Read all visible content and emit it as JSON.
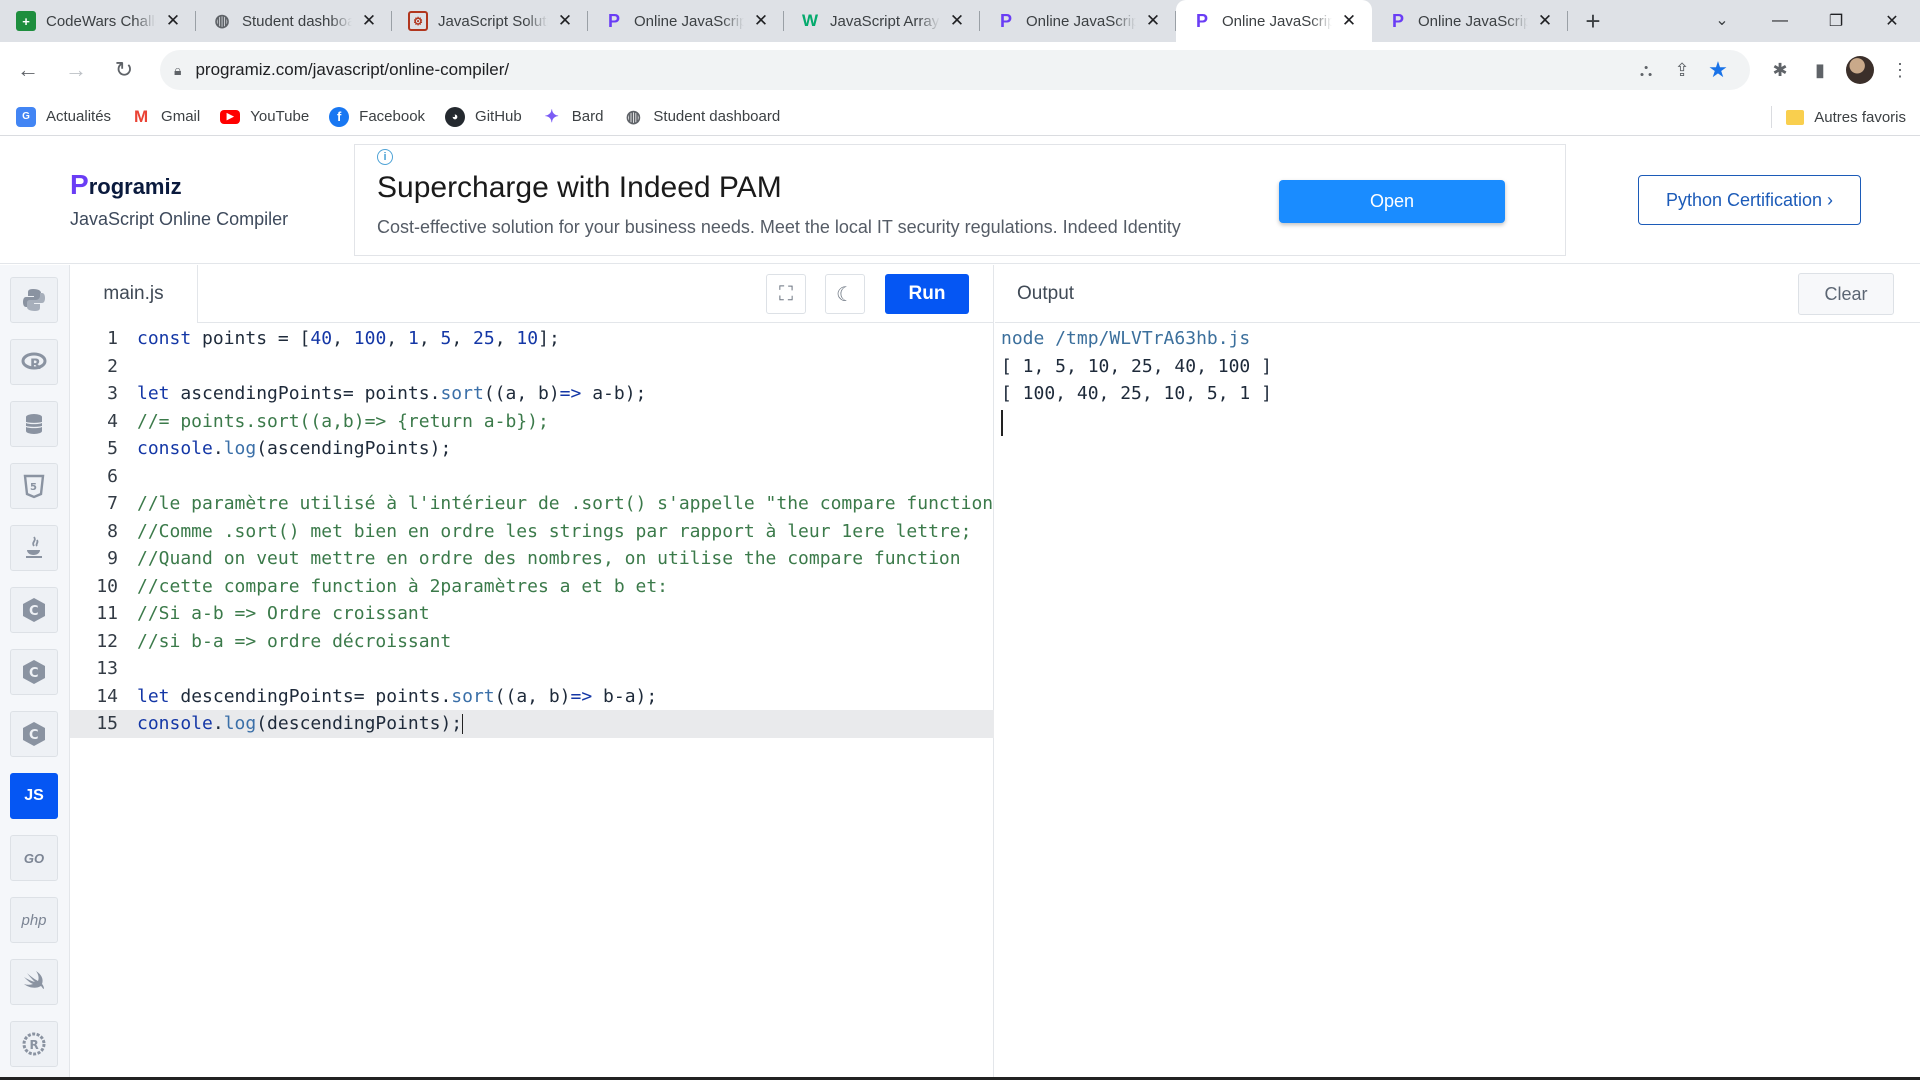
{
  "browser": {
    "tabs": [
      {
        "title": "CodeWars Challenges",
        "favicon": "green-plus-icon"
      },
      {
        "title": "Student dashboard",
        "favicon": "globe-icon"
      },
      {
        "title": "JavaScript Solutions",
        "favicon": "codewars-icon"
      },
      {
        "title": "Online JavaScript Compiler",
        "favicon": "programiz-icon"
      },
      {
        "title": "JavaScript Array Sort",
        "favicon": "w3schools-icon"
      },
      {
        "title": "Online JavaScript Compiler",
        "favicon": "programiz-icon"
      },
      {
        "title": "Online JavaScript Compiler",
        "favicon": "programiz-icon",
        "active": true
      },
      {
        "title": "Online JavaScript Compiler",
        "favicon": "programiz-icon"
      }
    ],
    "url": "programiz.com/javascript/online-compiler/",
    "bookmarks": [
      {
        "label": "Actualités",
        "icon": "news-icon"
      },
      {
        "label": "Gmail",
        "icon": "gmail-icon"
      },
      {
        "label": "YouTube",
        "icon": "youtube-icon"
      },
      {
        "label": "Facebook",
        "icon": "facebook-icon"
      },
      {
        "label": "GitHub",
        "icon": "github-icon"
      },
      {
        "label": "Bard",
        "icon": "bard-icon"
      },
      {
        "label": "Student dashboard",
        "icon": "globe-icon"
      }
    ],
    "other_bookmarks": "Autres favoris"
  },
  "header": {
    "logo": "rogramiz",
    "logo_initial": "P",
    "subtitle": "JavaScript Online Compiler",
    "ad": {
      "headline": "Supercharge with Indeed PAM",
      "description": "Cost-effective solution for your business needs. Meet the local IT security regulations. Indeed Identity",
      "button": "Open"
    },
    "certification_button": "Python Certification ›"
  },
  "sidebar": {
    "languages": [
      {
        "name": "python-icon",
        "label": ""
      },
      {
        "name": "r-icon",
        "label": ""
      },
      {
        "name": "sql-icon",
        "label": ""
      },
      {
        "name": "html-icon",
        "label": ""
      },
      {
        "name": "java-icon",
        "label": ""
      },
      {
        "name": "c-icon",
        "label": ""
      },
      {
        "name": "cpp-icon",
        "label": ""
      },
      {
        "name": "csharp-icon",
        "label": ""
      },
      {
        "name": "js-icon",
        "label": "JS",
        "active": true
      },
      {
        "name": "go-icon",
        "label": "GO"
      },
      {
        "name": "php-icon",
        "label": "php"
      },
      {
        "name": "swift-icon",
        "label": ""
      },
      {
        "name": "rust-icon",
        "label": ""
      }
    ]
  },
  "editor": {
    "filename": "main.js",
    "run_label": "Run",
    "lines": [
      {
        "n": "1",
        "text": "const points = [40, 100, 1, 5, 25, 10];"
      },
      {
        "n": "2",
        "text": ""
      },
      {
        "n": "3",
        "text": "let ascendingPoints= points.sort((a, b)=> a-b);"
      },
      {
        "n": "4",
        "text": "//= points.sort((a,b)=> {return a-b});"
      },
      {
        "n": "5",
        "text": "console.log(ascendingPoints);"
      },
      {
        "n": "6",
        "text": ""
      },
      {
        "n": "7",
        "text": "//le paramètre utilisé à l'intérieur de .sort() s'appelle \"the compare function\""
      },
      {
        "n": "8",
        "text": "//Comme .sort() met bien en ordre les strings par rapport à leur 1ere lettre;"
      },
      {
        "n": "9",
        "text": "//Quand on veut mettre en ordre des nombres, on utilise the compare function"
      },
      {
        "n": "10",
        "text": "//cette compare function à 2paramètres a et b et:"
      },
      {
        "n": "11",
        "text": "//Si a-b => Ordre croissant"
      },
      {
        "n": "12",
        "text": "//si b-a => ordre décroissant"
      },
      {
        "n": "13",
        "text": ""
      },
      {
        "n": "14",
        "text": "let descendingPoints= points.sort((a, b)=> b-a);"
      },
      {
        "n": "15",
        "text": "console.log(descendingPoints);"
      }
    ]
  },
  "output": {
    "title": "Output",
    "clear_label": "Clear",
    "lines": [
      "node /tmp/WLVTrA63hb.js",
      "[ 1, 5, 10, 25, 40, 100 ]",
      "[ 100, 40, 25, 10, 5, 1 ]"
    ]
  }
}
